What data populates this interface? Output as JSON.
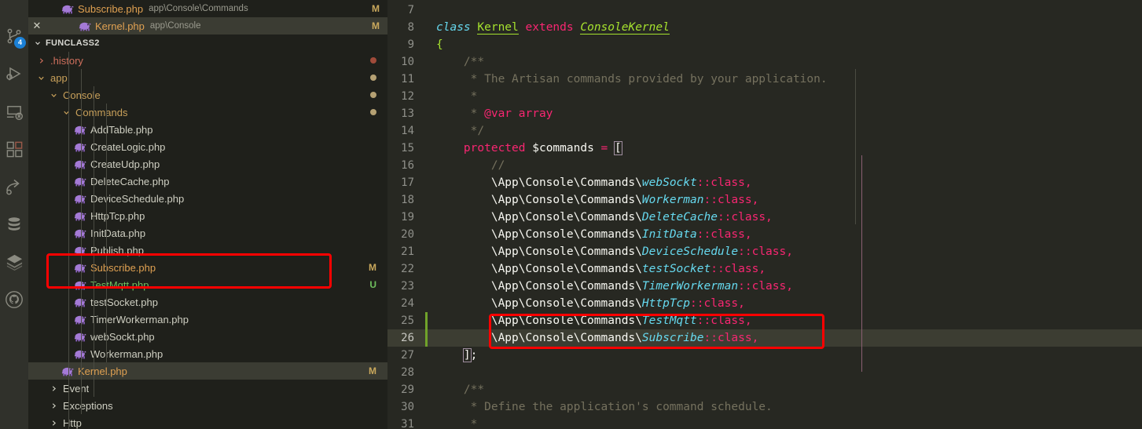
{
  "activity_bar": {
    "items": [
      {
        "name": "source-control-icon",
        "badge": "4"
      },
      {
        "name": "run-and-debug-icon",
        "badge": ""
      },
      {
        "name": "remote-explorer-icon",
        "badge": ""
      },
      {
        "name": "extensions-icon",
        "badge": ""
      },
      {
        "name": "share-export-icon",
        "badge": ""
      },
      {
        "name": "database-icon",
        "badge": ""
      },
      {
        "name": "layers-icon",
        "badge": ""
      },
      {
        "name": "github-icon",
        "badge": ""
      }
    ]
  },
  "open_editors": [
    {
      "name": "Subscribe.php",
      "path": "app\\Console\\Commands",
      "status": "M",
      "active": false,
      "close": ""
    },
    {
      "name": "Kernel.php",
      "path": "app\\Console",
      "status": "M",
      "active": true,
      "close": "✕"
    }
  ],
  "explorer": {
    "root_label": "FUNCLASS2",
    "rows": [
      {
        "label": ".history",
        "kind": "folder",
        "expanded": false,
        "depth": 1,
        "color": "#ce6f5c",
        "dot": "#a04b3a",
        "status": ""
      },
      {
        "label": "app",
        "kind": "folder",
        "expanded": true,
        "depth": 1,
        "color": "#c8a05a",
        "dot": "#b5a173",
        "status": ""
      },
      {
        "label": "Console",
        "kind": "folder",
        "expanded": true,
        "depth": 2,
        "color": "#c8a05a",
        "dot": "#b5a173",
        "status": ""
      },
      {
        "label": "Commands",
        "kind": "folder",
        "expanded": true,
        "depth": 3,
        "color": "#c8a05a",
        "dot": "#b5a173",
        "status": ""
      },
      {
        "label": "AddTable.php",
        "kind": "file",
        "depth": 4,
        "color": "#cfcfc2",
        "status": ""
      },
      {
        "label": "CreateLogic.php",
        "kind": "file",
        "depth": 4,
        "color": "#cfcfc2",
        "status": ""
      },
      {
        "label": "CreateUdp.php",
        "kind": "file",
        "depth": 4,
        "color": "#cfcfc2",
        "status": ""
      },
      {
        "label": "DeleteCache.php",
        "kind": "file",
        "depth": 4,
        "color": "#cfcfc2",
        "status": ""
      },
      {
        "label": "DeviceSchedule.php",
        "kind": "file",
        "depth": 4,
        "color": "#cfcfc2",
        "status": ""
      },
      {
        "label": "HttpTcp.php",
        "kind": "file",
        "depth": 4,
        "color": "#cfcfc2",
        "status": ""
      },
      {
        "label": "InitData.php",
        "kind": "file",
        "depth": 4,
        "color": "#cfcfc2",
        "status": ""
      },
      {
        "label": "Publish.php",
        "kind": "file",
        "depth": 4,
        "color": "#cfcfc2",
        "status": ""
      },
      {
        "label": "Subscribe.php",
        "kind": "file",
        "depth": 4,
        "color": "#e0a152",
        "status": "M",
        "status_color": "#c9a85c"
      },
      {
        "label": "TestMqtt.php",
        "kind": "file",
        "depth": 4,
        "color": "#6fbf5e",
        "status": "U",
        "status_color": "#6fbf5e"
      },
      {
        "label": "testSocket.php",
        "kind": "file",
        "depth": 4,
        "color": "#cfcfc2",
        "status": ""
      },
      {
        "label": "TimerWorkerman.php",
        "kind": "file",
        "depth": 4,
        "color": "#cfcfc2",
        "status": ""
      },
      {
        "label": "webSockt.php",
        "kind": "file",
        "depth": 4,
        "color": "#cfcfc2",
        "status": ""
      },
      {
        "label": "Workerman.php",
        "kind": "file",
        "depth": 4,
        "color": "#cfcfc2",
        "status": ""
      },
      {
        "label": "Kernel.php",
        "kind": "file",
        "depth": 3,
        "color": "#e0a152",
        "status": "M",
        "status_color": "#c9a85c",
        "selected": true
      },
      {
        "label": "Event",
        "kind": "folder",
        "expanded": false,
        "depth": 2,
        "color": "#cfcfc2",
        "status": ""
      },
      {
        "label": "Exceptions",
        "kind": "folder",
        "expanded": false,
        "depth": 2,
        "color": "#cfcfc2",
        "status": ""
      },
      {
        "label": "Http",
        "kind": "folder",
        "expanded": false,
        "depth": 2,
        "color": "#cfcfc2",
        "status": ""
      }
    ]
  },
  "editor": {
    "filename": "Kernel.php",
    "first_visible_line": 7,
    "current_line": 26,
    "added_lines": [
      25,
      26
    ],
    "lines": [
      {
        "n": 7,
        "tokens": []
      },
      {
        "n": 8,
        "tokens": [
          {
            "t": "class ",
            "c": "t-kw-i"
          },
          {
            "t": "Kernel",
            "c": "t-type u-line"
          },
          {
            "t": " ",
            "c": "t-plain"
          },
          {
            "t": "extends",
            "c": "t-kw"
          },
          {
            "t": " ",
            "c": "t-plain"
          },
          {
            "t": "ConsoleKernel",
            "c": "t-type-i u-line"
          }
        ]
      },
      {
        "n": 9,
        "tokens": [
          {
            "t": "{",
            "c": "t-type"
          }
        ]
      },
      {
        "n": 10,
        "tokens": [
          {
            "t": "    /**",
            "c": "t-comment"
          }
        ]
      },
      {
        "n": 11,
        "tokens": [
          {
            "t": "     * The Artisan commands provided by your application.",
            "c": "t-comment"
          }
        ]
      },
      {
        "n": 12,
        "tokens": [
          {
            "t": "     *",
            "c": "t-comment"
          }
        ]
      },
      {
        "n": 13,
        "tokens": [
          {
            "t": "     * ",
            "c": "t-comment"
          },
          {
            "t": "@var array",
            "c": "t-kw"
          }
        ]
      },
      {
        "n": 14,
        "tokens": [
          {
            "t": "     */",
            "c": "t-comment"
          }
        ]
      },
      {
        "n": 15,
        "tokens": [
          {
            "t": "    ",
            "c": "t-plain"
          },
          {
            "t": "protected",
            "c": "t-kw"
          },
          {
            "t": " ",
            "c": "t-plain"
          },
          {
            "t": "$commands",
            "c": "t-plain"
          },
          {
            "t": " ",
            "c": "t-plain"
          },
          {
            "t": "=",
            "c": "t-op"
          },
          {
            "t": " ",
            "c": "t-plain"
          },
          {
            "t": "[",
            "c": "t-punc bracket-box"
          }
        ]
      },
      {
        "n": 16,
        "tokens": [
          {
            "t": "        //",
            "c": "t-comment"
          }
        ]
      },
      {
        "n": 17,
        "tokens": [
          {
            "t": "        \\App\\Console\\Commands\\",
            "c": "t-plain"
          },
          {
            "t": "webSockt",
            "c": "t-cls"
          },
          {
            "t": "::class,",
            "c": "t-kw"
          }
        ]
      },
      {
        "n": 18,
        "tokens": [
          {
            "t": "        \\App\\Console\\Commands\\",
            "c": "t-plain"
          },
          {
            "t": "Workerman",
            "c": "t-cls"
          },
          {
            "t": "::class,",
            "c": "t-kw"
          }
        ]
      },
      {
        "n": 19,
        "tokens": [
          {
            "t": "        \\App\\Console\\Commands\\",
            "c": "t-plain"
          },
          {
            "t": "DeleteCache",
            "c": "t-cls"
          },
          {
            "t": "::class,",
            "c": "t-kw"
          }
        ]
      },
      {
        "n": 20,
        "tokens": [
          {
            "t": "        \\App\\Console\\Commands\\",
            "c": "t-plain"
          },
          {
            "t": "InitData",
            "c": "t-cls"
          },
          {
            "t": "::class,",
            "c": "t-kw"
          }
        ]
      },
      {
        "n": 21,
        "tokens": [
          {
            "t": "        \\App\\Console\\Commands\\",
            "c": "t-plain"
          },
          {
            "t": "DeviceSchedule",
            "c": "t-cls"
          },
          {
            "t": "::class,",
            "c": "t-kw"
          }
        ]
      },
      {
        "n": 22,
        "tokens": [
          {
            "t": "        \\App\\Console\\Commands\\",
            "c": "t-plain"
          },
          {
            "t": "testSocket",
            "c": "t-cls"
          },
          {
            "t": "::class,",
            "c": "t-kw"
          }
        ]
      },
      {
        "n": 23,
        "tokens": [
          {
            "t": "        \\App\\Console\\Commands\\",
            "c": "t-plain"
          },
          {
            "t": "TimerWorkerman",
            "c": "t-cls"
          },
          {
            "t": "::class,",
            "c": "t-kw"
          }
        ]
      },
      {
        "n": 24,
        "tokens": [
          {
            "t": "        \\App\\Console\\Commands\\",
            "c": "t-plain"
          },
          {
            "t": "HttpTcp",
            "c": "t-cls"
          },
          {
            "t": "::class,",
            "c": "t-kw"
          }
        ]
      },
      {
        "n": 25,
        "tokens": [
          {
            "t": "        \\App\\Console\\Commands\\",
            "c": "t-plain"
          },
          {
            "t": "TestMqtt",
            "c": "t-cls"
          },
          {
            "t": "::class,",
            "c": "t-kw"
          }
        ]
      },
      {
        "n": 26,
        "tokens": [
          {
            "t": "        \\App\\Console\\Commands\\",
            "c": "t-plain"
          },
          {
            "t": "Subscribe",
            "c": "t-cls"
          },
          {
            "t": "::class,",
            "c": "t-kw"
          }
        ]
      },
      {
        "n": 27,
        "tokens": [
          {
            "t": "    ",
            "c": "t-plain"
          },
          {
            "t": "]",
            "c": "t-punc bracket-box"
          },
          {
            "t": ";",
            "c": "t-plain"
          }
        ]
      },
      {
        "n": 28,
        "tokens": []
      },
      {
        "n": 29,
        "tokens": [
          {
            "t": "    /**",
            "c": "t-comment"
          }
        ]
      },
      {
        "n": 30,
        "tokens": [
          {
            "t": "     * Define the application's command schedule.",
            "c": "t-comment"
          }
        ]
      },
      {
        "n": 31,
        "tokens": [
          {
            "t": "     *",
            "c": "t-comment"
          }
        ]
      }
    ]
  },
  "annotations": {
    "accent_color": "#fe0000",
    "boxes": [
      {
        "name": "explorer-highlight",
        "label": "Subscribe.php / TestMqtt.php"
      },
      {
        "name": "code-highlight",
        "label": "TestMqtt::class / Subscribe::class"
      }
    ]
  }
}
